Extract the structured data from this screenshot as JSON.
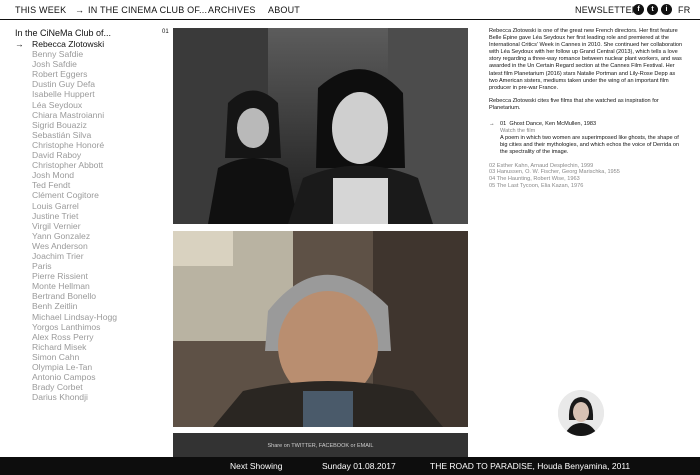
{
  "nav": {
    "this_week": "THIS WEEK",
    "arrow": "→",
    "club": "IN THE CINEMA CLUB OF...",
    "archives": "ARCHIVES",
    "about": "ABOUT",
    "newsletter": "NEWSLETTER",
    "social": {
      "facebook": "f",
      "twitter": "t",
      "instagram": "i"
    },
    "language": "FR"
  },
  "sidebar": {
    "title": "In the CiNeMa Club of...",
    "active_arrow": "→",
    "items": [
      "Rebecca Zlotowski",
      "Benny Safdie",
      "Josh Safdie",
      "Robert Eggers",
      "Dustin Guy Defa",
      "Isabelle Huppert",
      "Léa Seydoux",
      "Chiara Mastroianni",
      "Sigrid Bouaziz",
      "Sebastián Silva",
      "Christophe Honoré",
      "David Raboy",
      "Christopher Abbott",
      "Josh Mond",
      "Ted Fendt",
      "Clément Cogitore",
      "Louis Garrel",
      "Justine Triet",
      "Virgil Vernier",
      "Yann Gonzalez",
      "Wes Anderson",
      "Joachim Trier",
      "Paris",
      "Pierre Rissient",
      "Monte Hellman",
      "Bertrand Bonello",
      "Benh Zeitlin",
      "Michael Lindsay-Hogg",
      "Yorgos Lanthimos",
      "Alex Ross Perry",
      "Richard Misek",
      "Simon Cahn",
      "Olympia Le-Tan",
      "Antonio Campos",
      "Brady Corbet",
      "Darius Khondji"
    ]
  },
  "stills": {
    "number": "01",
    "share_text": "Share on TWITTER, FACEBOOK or EMAIL"
  },
  "bio": {
    "text": "Rebecca Zlotowski is one of the great new French directors. Her first feature Belle Épine gave Léa Seydoux her first leading role and premiered at the International Critics' Week in Cannes in 2010. She continued her collaboration with Léa Seydoux with her follow up Grand Central (2013), which tells a love story regarding a three-way romance between nuclear plant workers, and was awarded in the Un Certain Regard section at the Cannes Film Festival. Her latest film Planetarium (2016) stars Natalie Portman and Lily-Rose Depp as two American sisters, mediums taken under the wing of an important film producer in pre-war France.",
    "inspiration": "Rebecca Zlotowski cites five films that she watched as inspiration for Planetarium."
  },
  "films": {
    "featured": {
      "arrow": "→",
      "number": "01",
      "title": "Ghost Dance, Ken McMullen, 1983",
      "watch": "Watch the film",
      "description": "A poem in which two women are superimposed like ghosts, the shape of big cities and their mythologies, and which echos the voice of Derrida on the spectrality of the image."
    },
    "others": [
      "02  Esther Kahn, Arnaud Desplechin, 1999",
      "03  Hanussen, O. W. Fischer, Georg Marischka, 1955",
      "04  The Haunting, Robert Wise, 1963",
      "05  The Last Tycoon, Elia Kazan, 1976"
    ]
  },
  "bottom": {
    "next_label": "Next Showing",
    "date": "Sunday 01.08.2017",
    "film": "THE ROAD TO PARADISE, Houda Benyamina, 2011"
  }
}
